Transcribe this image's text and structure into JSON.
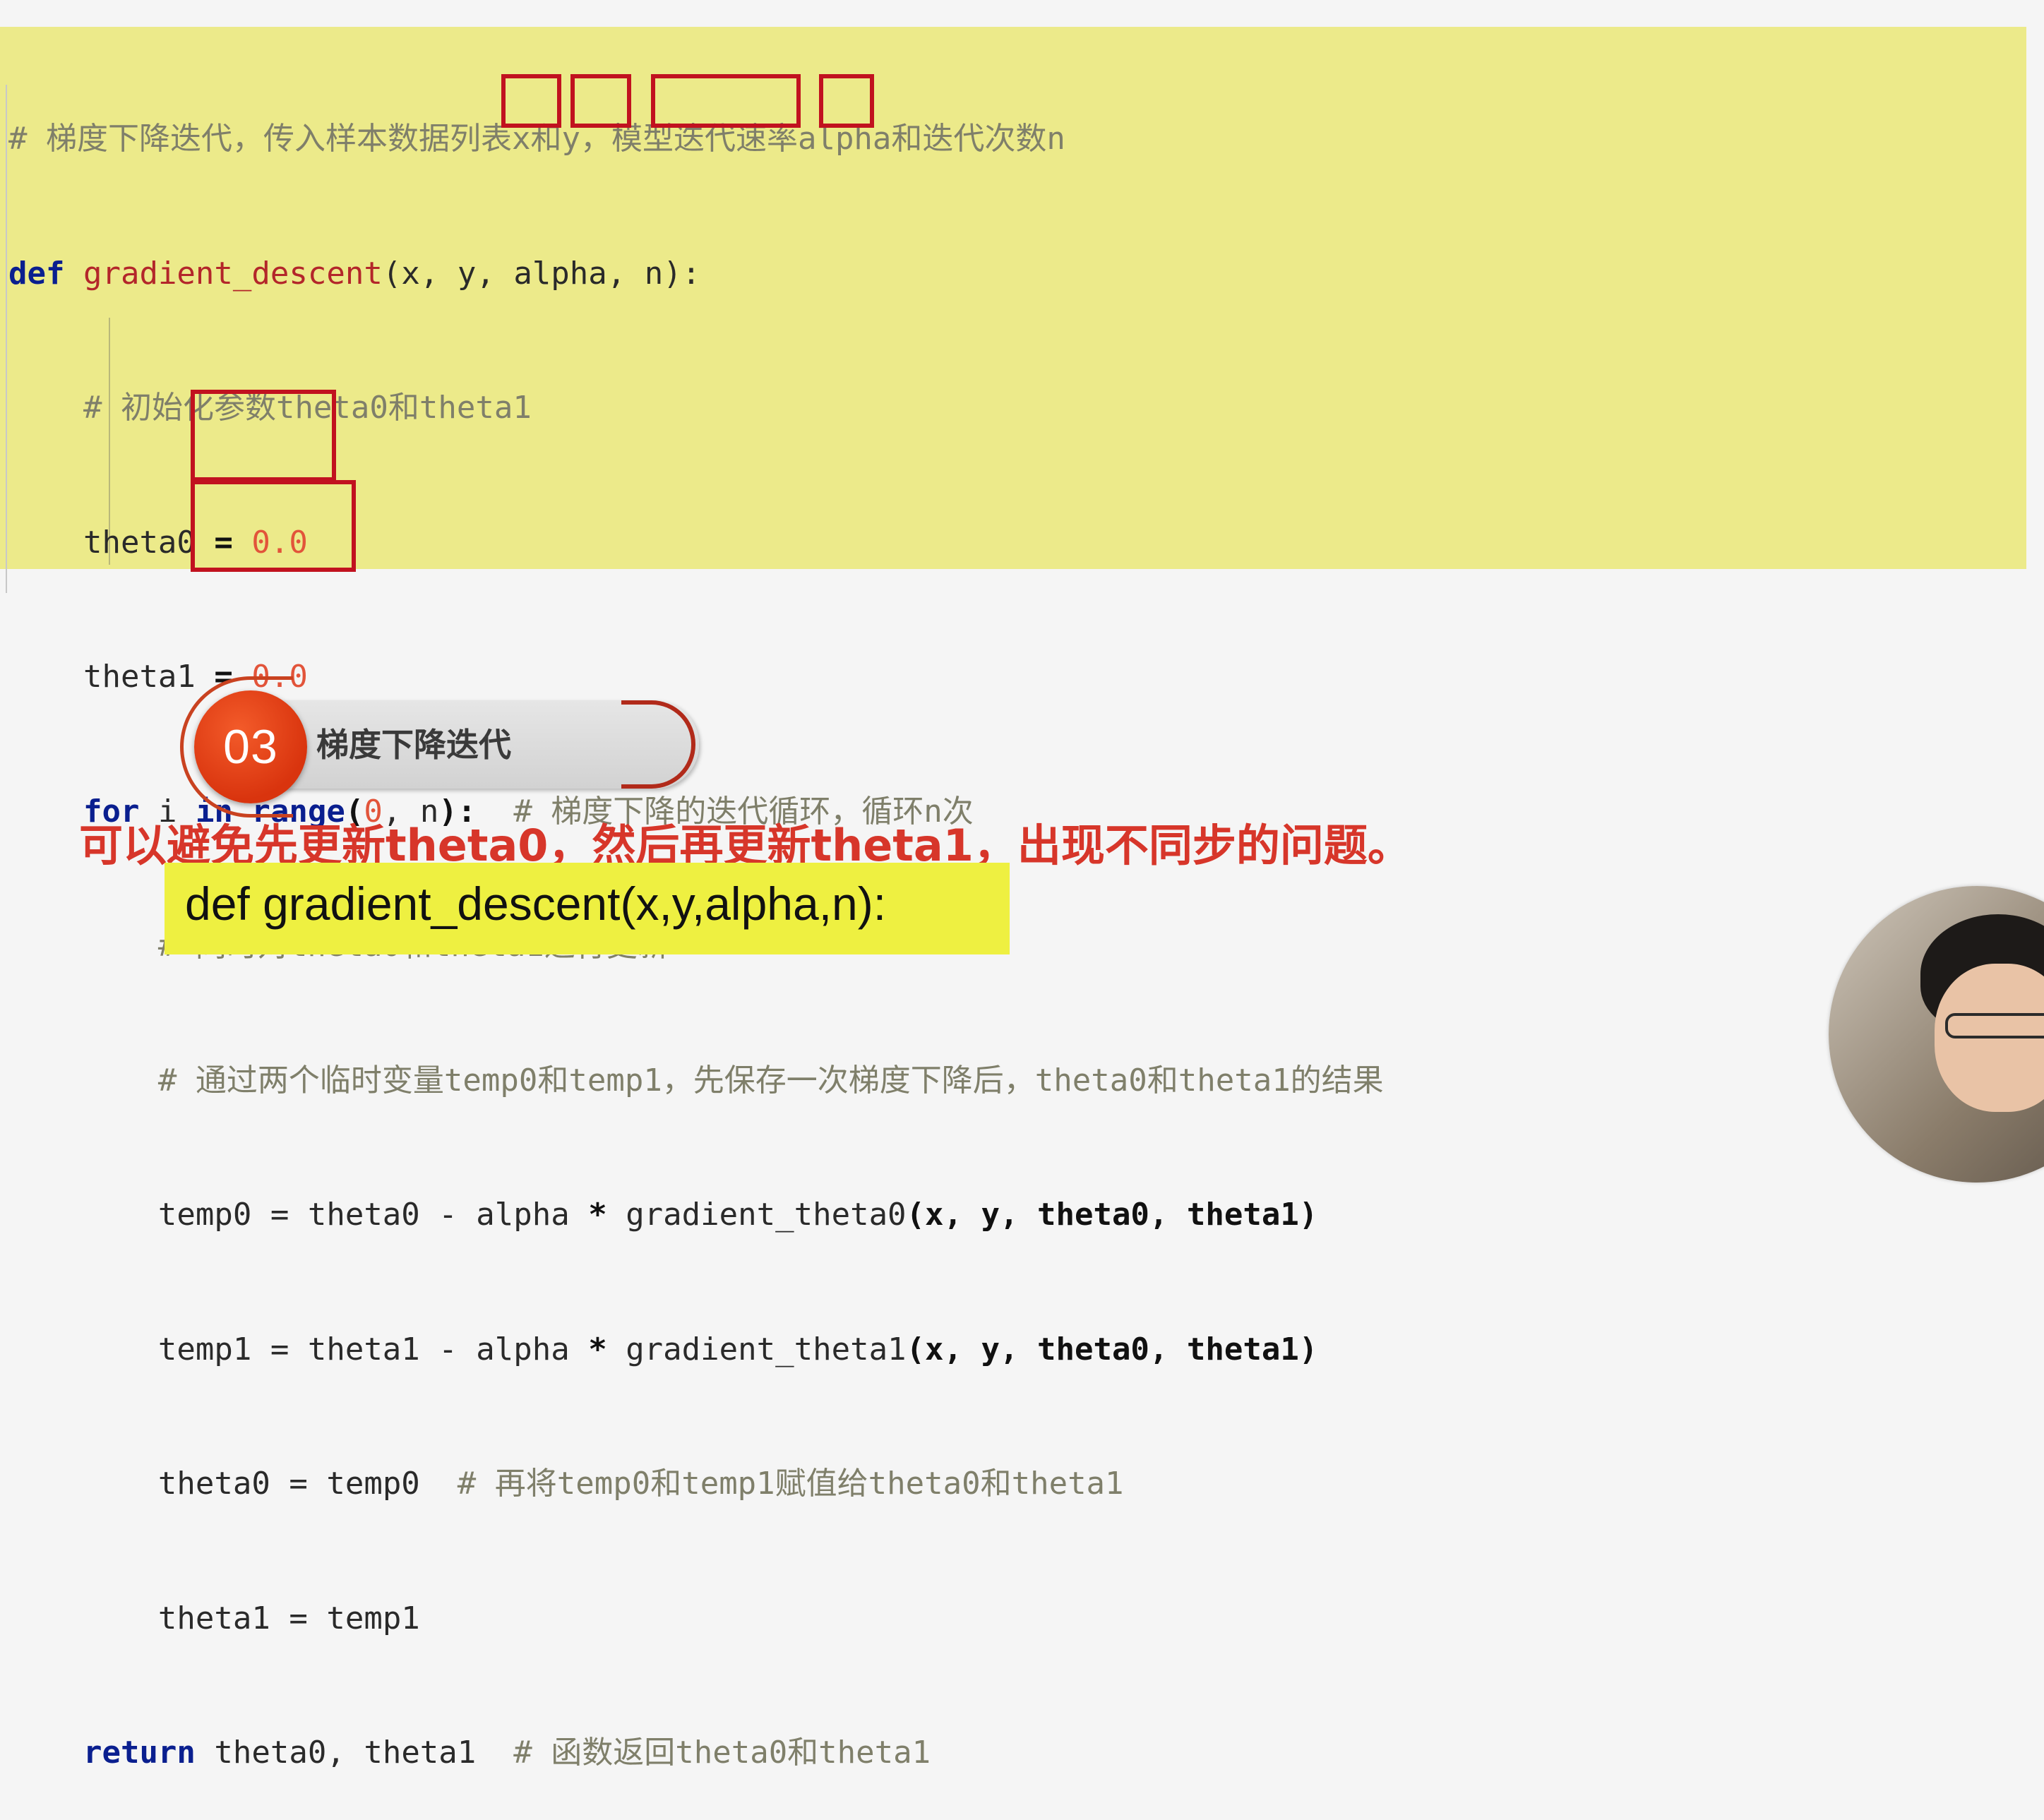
{
  "code": {
    "line1": {
      "comment": "# 梯度下降迭代，传入样本数据列表x和y，模型迭代速率alpha和迭代次数n"
    },
    "line2": {
      "kw_def": "def",
      "fn_name": "gradient_descent",
      "open": "(",
      "p_x": "x",
      "sep1": ",",
      "p_y": "y",
      "sep2": ",",
      "p_alpha": "alpha",
      "sep3": ",",
      "p_n": "n",
      "close": "):"
    },
    "line3": {
      "comment": "# 初始化参数theta0和theta1"
    },
    "line4": {
      "lhs": "theta0",
      "eq": " = ",
      "val": "0.0"
    },
    "line5": {
      "lhs": "theta1",
      "eq": " = ",
      "val": "0.0"
    },
    "line6": {
      "kw_for": "for",
      "var": " i ",
      "kw_in": "in",
      "kw_range": " range",
      "open": "(",
      "start": "0",
      "rest": ", n",
      "close": "):",
      "comment": "  # 梯度下降的迭代循环，循环n次"
    },
    "line7": {
      "comment": "# 同时对theta0和theta1进行更新"
    },
    "line8": {
      "comment": "# 通过两个临时变量temp0和temp1，先保存一次梯度下降后，theta0和theta1的结果"
    },
    "line9": {
      "lhs": "temp0",
      "rhs_a": " = theta0 - alpha ",
      "star": "*",
      "rhs_b": " gradient_theta0",
      "args": "(x, y, theta0, theta1)"
    },
    "line10": {
      "lhs": "temp1",
      "rhs_a": " = theta1 - alpha ",
      "star": "*",
      "rhs_b": " gradient_theta1",
      "args": "(x, y, theta0, theta1)"
    },
    "line11": {
      "lhs": "theta0",
      "rhs": " = temp0",
      "comment": "  # 再将temp0和temp1赋值给theta0和theta1"
    },
    "line12": {
      "lhs": "theta1",
      "rhs": " = temp1"
    },
    "line13": {
      "kw_return": "return",
      "rest": " theta0, theta1",
      "comment": "  # 函数返回theta0和theta1"
    }
  },
  "section": {
    "number": "03",
    "title": "梯度下降迭代"
  },
  "subtitle": "可以避免先更新theta0，然后再更新theta1，出现不同步的问题。",
  "caption": "def gradient_descent(x,y,alpha,n):",
  "colors": {
    "highlight_bg": "#ecea8a",
    "keyword": "#0a1f8f",
    "function_name": "#b3262a",
    "number": "#e2543a",
    "comment": "#7f7f6a",
    "box_red": "#c1121f",
    "badge_orange": "#d9340e",
    "subtitle_red": "#d7362a",
    "caption_yellow": "#eef041"
  },
  "icons": {
    "avatar": "presenter-avatar"
  }
}
